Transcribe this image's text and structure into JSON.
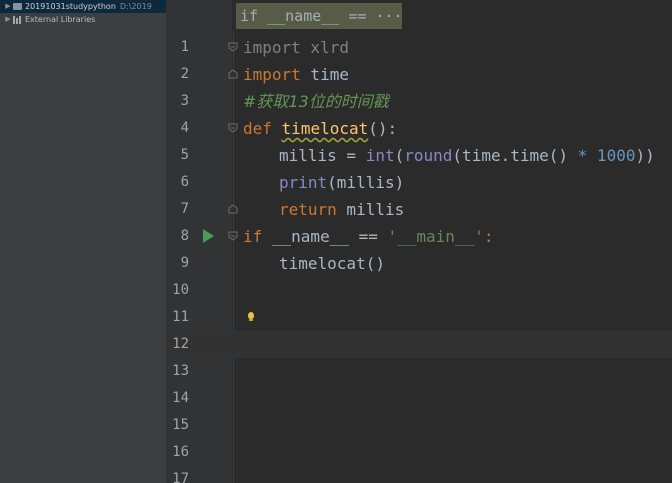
{
  "sidebar": {
    "project_name": "20191031studypython",
    "project_path": "D:\\2019",
    "external_libraries": "External Libraries"
  },
  "editor": {
    "sticky_header": "if __name__ == ···",
    "line_numbers": [
      "1",
      "2",
      "3",
      "4",
      "5",
      "6",
      "7",
      "8",
      "9",
      "10",
      "11",
      "12",
      "13",
      "14",
      "15",
      "16",
      "17"
    ],
    "lines": {
      "l1": {
        "kw": "import",
        "rest": " xlrd"
      },
      "l2": {
        "kw": "import",
        "rest": " time"
      },
      "l3": {
        "comment": "#获取13位的时间戳"
      },
      "l4": {
        "kw": "def",
        "sp": " ",
        "fn": "timelocat",
        "rest": "():"
      },
      "l5": {
        "a": "millis = ",
        "b1": "int",
        "b2": "round",
        "c": "(time.time() ",
        "op": "*",
        "num": " 1000",
        "d": "))"
      },
      "l6": {
        "bi": "print",
        "rest": "(millis)"
      },
      "l7": {
        "kw": "return",
        "rest": " millis"
      },
      "l8": {
        "kw": "if",
        "d1": " __name__",
        "op": " == ",
        "str": "'__main__'",
        "rest": ":"
      },
      "l9": {
        "rest": "timelocat()"
      }
    }
  }
}
